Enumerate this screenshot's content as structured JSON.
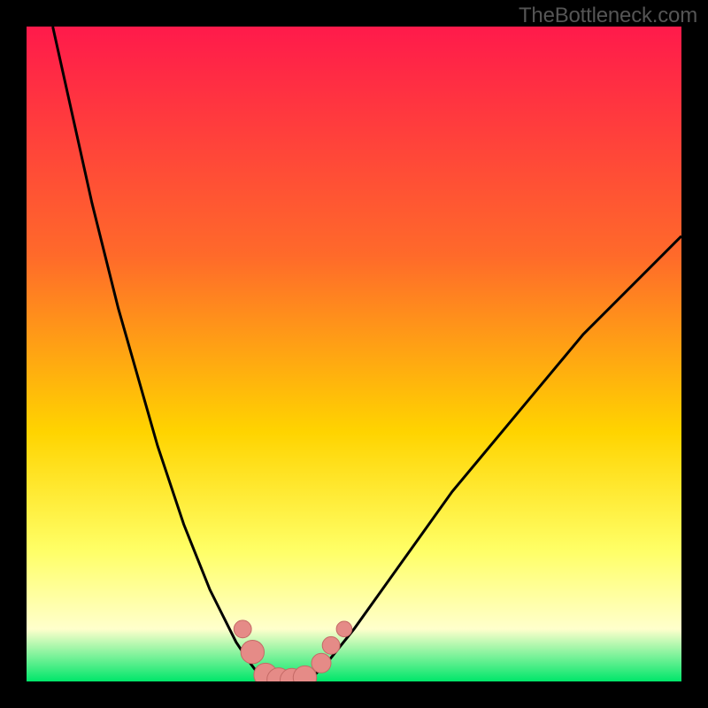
{
  "attribution": "TheBottleneck.com",
  "colors": {
    "frame": "#000000",
    "gradient_top": "#ff1a4b",
    "gradient_mid1": "#ff6a2a",
    "gradient_mid2": "#ffd400",
    "gradient_low": "#ffff66",
    "gradient_pale": "#ffffcc",
    "gradient_bottom": "#00e66a",
    "curve": "#000000",
    "marker_fill": "#e58b87",
    "marker_stroke": "#c46a66"
  },
  "chart_data": {
    "type": "line",
    "title": "",
    "xlabel": "",
    "ylabel": "",
    "xlim": [
      0,
      100
    ],
    "ylim": [
      0,
      100
    ],
    "series": [
      {
        "name": "left-curve",
        "x": [
          4,
          6,
          8,
          10,
          12,
          14,
          16,
          18,
          20,
          22,
          24,
          26,
          28,
          30,
          32,
          34,
          35.5,
          37
        ],
        "values": [
          100,
          91,
          82,
          73,
          65,
          57,
          50,
          43,
          36,
          30,
          24,
          19,
          14,
          10,
          6,
          3,
          1,
          0
        ]
      },
      {
        "name": "floor",
        "x": [
          37,
          38,
          39,
          40,
          41,
          42,
          43
        ],
        "values": [
          0,
          0,
          0,
          0,
          0,
          0,
          0
        ]
      },
      {
        "name": "right-curve",
        "x": [
          43,
          46,
          50,
          55,
          60,
          65,
          70,
          75,
          80,
          85,
          90,
          95,
          100
        ],
        "values": [
          0,
          3,
          8,
          15,
          22,
          29,
          35,
          41,
          47,
          53,
          58,
          63,
          68
        ]
      }
    ],
    "markers": [
      {
        "name": "left-dot-upper",
        "x": 33.0,
        "y": 8.0,
        "r": 4.5
      },
      {
        "name": "left-dot-lower",
        "x": 34.5,
        "y": 4.5,
        "r": 6.0
      },
      {
        "name": "floor-dot-1",
        "x": 36.5,
        "y": 1.0,
        "r": 6.0
      },
      {
        "name": "floor-dot-2",
        "x": 38.5,
        "y": 0.3,
        "r": 6.0
      },
      {
        "name": "floor-dot-3",
        "x": 40.5,
        "y": 0.2,
        "r": 6.0
      },
      {
        "name": "floor-dot-4",
        "x": 42.5,
        "y": 0.6,
        "r": 6.0
      },
      {
        "name": "right-dot-lower",
        "x": 45.0,
        "y": 2.8,
        "r": 5.0
      },
      {
        "name": "right-dot-mid",
        "x": 46.5,
        "y": 5.5,
        "r": 4.5
      },
      {
        "name": "right-dot-upper",
        "x": 48.5,
        "y": 8.0,
        "r": 4.0
      }
    ],
    "gradient_stops": [
      {
        "pct": 0,
        "key": "gradient_top"
      },
      {
        "pct": 35,
        "key": "gradient_mid1"
      },
      {
        "pct": 62,
        "key": "gradient_mid2"
      },
      {
        "pct": 80,
        "key": "gradient_low"
      },
      {
        "pct": 92,
        "key": "gradient_pale"
      },
      {
        "pct": 100,
        "key": "gradient_bottom"
      }
    ]
  }
}
